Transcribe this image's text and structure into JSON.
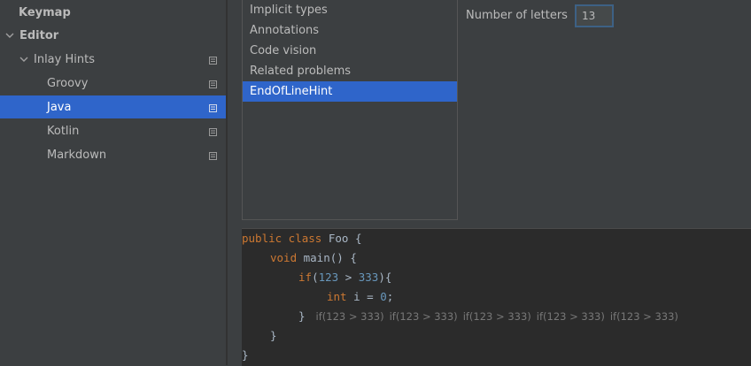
{
  "sidebar": {
    "items": [
      {
        "label": "Keymap",
        "bold": true,
        "chevron": "none"
      },
      {
        "label": "Editor",
        "bold": true,
        "chevron": "down"
      },
      {
        "label": "Inlay Hints",
        "bold": false,
        "chevron": "down"
      },
      {
        "label": "Groovy",
        "bold": false,
        "chevron": "none"
      },
      {
        "label": "Java",
        "bold": false,
        "chevron": "none",
        "selected": true
      },
      {
        "label": "Kotlin",
        "bold": false,
        "chevron": "none"
      },
      {
        "label": "Markdown",
        "bold": false,
        "chevron": "none"
      }
    ]
  },
  "hints_list": {
    "items": [
      "Implicit types",
      "Annotations",
      "Code vision",
      "Related problems",
      "EndOfLineHint"
    ],
    "selected_index": 4
  },
  "options": {
    "letters_label": "Number of letters",
    "letters_value": "13"
  },
  "preview": {
    "line1_kw": "public class",
    "line1_rest": " Foo {",
    "line2_kw": "void",
    "line2_rest": " main() {",
    "line3_kw": "if",
    "line3_a": "(",
    "line3_n1": "123",
    "line3_b": " > ",
    "line3_n2": "333",
    "line3_c": "){",
    "line4_kw": "int",
    "line4_a": " i = ",
    "line4_n": "0",
    "line4_b": ";",
    "line5_brace": "}",
    "line5_hints": [
      "if(123 > 333)",
      "if(123 > 333)",
      "if(123 > 333)",
      "if(123 > 333)",
      "if(123 > 333)"
    ],
    "line6": "}",
    "line7": "}"
  },
  "colors": {
    "selection": "#2f65ca",
    "keyword": "#cc7832",
    "number": "#6897bb",
    "hint": "#787878"
  }
}
